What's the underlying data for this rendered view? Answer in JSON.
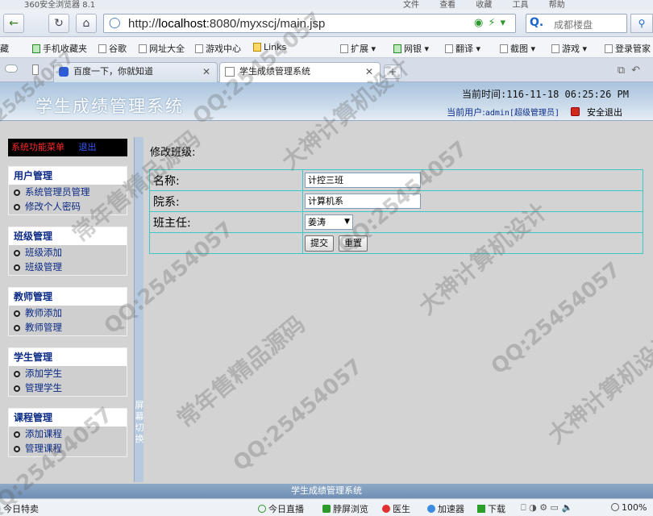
{
  "browser": {
    "window_title": "360安全浏览器 8.1",
    "menu_items": [
      "文件",
      "查看",
      "收藏",
      "工具",
      "帮助"
    ],
    "address_prefix": "http://",
    "address_host": "localhost",
    "address_rest": ":8080/myxscj/main.jsp",
    "search_placeholder": "成都楼盘",
    "favorites": [
      {
        "label": "藏",
        "icon": "bookmark-icon"
      },
      {
        "label": "手机收藏夹",
        "icon": "phone-icon"
      },
      {
        "label": "谷歌",
        "icon": "page-icon"
      },
      {
        "label": "网址大全",
        "icon": "page-icon"
      },
      {
        "label": "游戏中心",
        "icon": "gamepad-icon"
      },
      {
        "label": "Links",
        "icon": "folder-icon"
      },
      {
        "label": "扩展",
        "icon": "extension-icon"
      },
      {
        "label": "网银",
        "icon": "bank-icon"
      },
      {
        "label": "翻译",
        "icon": "translate-icon"
      },
      {
        "label": "截图",
        "icon": "scissors-icon"
      },
      {
        "label": "游戏",
        "icon": "gamepad-icon"
      },
      {
        "label": "登录管家",
        "icon": "key-icon"
      }
    ],
    "tabs": [
      {
        "label": "百度一下，你就知道"
      },
      {
        "label": "学生成绩管理系统"
      }
    ]
  },
  "app": {
    "title": "学生成绩管理系统",
    "clock_label": "当前时间:",
    "clock_value": "116-11-18 06:25:26 PM",
    "user_label": "当前用户:",
    "user_value": "admin[超级管理员]",
    "logout_label": "安全退出",
    "footer_text": "学生成绩管理系统"
  },
  "sidebar": {
    "header_title": "系统功能菜单",
    "header_exit": "退出",
    "groups": [
      {
        "title": "用户管理",
        "items": [
          "系统管理员管理",
          "修改个人密码"
        ]
      },
      {
        "title": "班级管理",
        "items": [
          "班级添加",
          "班级管理"
        ]
      },
      {
        "title": "教师管理",
        "items": [
          "教师添加",
          "教师管理"
        ]
      },
      {
        "title": "学生管理",
        "items": [
          "添加学生",
          "管理学生"
        ]
      },
      {
        "title": "课程管理",
        "items": [
          "添加课程",
          "管理课程"
        ]
      }
    ],
    "splitter_label": "屏幕切换"
  },
  "form": {
    "page_title": "修改班级:",
    "name_label": "名称:",
    "name_value": "计控三班",
    "dept_label": "院系:",
    "dept_value": "计算机系",
    "teacher_label": "班主任:",
    "teacher_value": "姜涛",
    "submit_label": "提交",
    "reset_label": "重置"
  },
  "statusbar": {
    "left": "今日特卖",
    "live": "今日直播",
    "fullscreen": "脖屏浏览",
    "doctor": "医生",
    "accelerator": "加速器",
    "download": "下载",
    "zoom": "100%"
  },
  "watermark": {
    "qq": "QQ:25454057",
    "brand1": "大神计算机设计",
    "brand2": "常年售精品源码"
  }
}
